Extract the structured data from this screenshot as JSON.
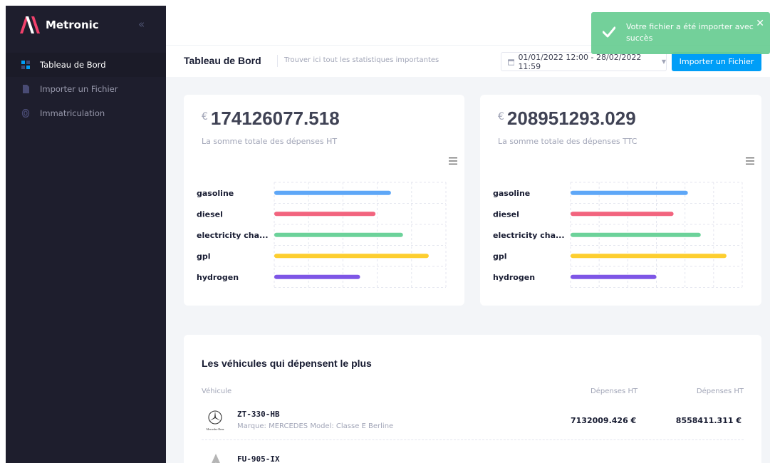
{
  "sidebar": {
    "brand": "Metronic",
    "items": [
      {
        "label": "Tableau de Bord",
        "active": true
      },
      {
        "label": "Importer un Fichier",
        "active": false
      },
      {
        "label": "Immatriculation",
        "active": false
      }
    ]
  },
  "subheader": {
    "title": "Tableau de Bord",
    "description": "Trouver ici tout les statistiques importantes",
    "date_range": "01/01/2022 12:00 - 28/02/2022 11:59",
    "import_label": "Importer un Fichier"
  },
  "toast": {
    "message": "Votre fichier a été importer avec succès"
  },
  "stats": [
    {
      "currency": "€",
      "value": "174126077.518",
      "label": "La somme totale des dépenses HT"
    },
    {
      "currency": "€",
      "value": "208951293.029",
      "label": "La somme totale des dépenses TTC"
    }
  ],
  "chart_data": [
    {
      "type": "bar",
      "orientation": "horizontal",
      "categories": [
        "gasoline",
        "diesel",
        "electricity cha...",
        "gpl",
        "hydrogen"
      ],
      "values": [
        34000000,
        29500000,
        37500000,
        45000000,
        25000000
      ],
      "xlim": [
        0,
        50000000
      ],
      "ticks": [
        "0M €",
        "10M €",
        "20M €",
        "30M €",
        "40M €",
        "50M €"
      ],
      "grid": true,
      "colors": [
        "#5ea7f7",
        "#f2647e",
        "#6cd29a",
        "#fdce2f",
        "#7e56e6"
      ]
    },
    {
      "type": "bar",
      "orientation": "horizontal",
      "categories": [
        "gasoline",
        "diesel",
        "electricity cha...",
        "gpl",
        "hydrogen"
      ],
      "values": [
        41000000,
        36000000,
        45500000,
        54500000,
        30000000
      ],
      "xlim": [
        0,
        60000000
      ],
      "ticks": [
        "0M €",
        "10M €",
        "20M €",
        "30M €",
        "40M €",
        "50M €",
        "60M €"
      ],
      "grid": true,
      "colors": [
        "#5ea7f7",
        "#f2647e",
        "#6cd29a",
        "#fdce2f",
        "#7e56e6"
      ]
    }
  ],
  "vehicles": {
    "title": "Les véhicules qui dépensent le plus",
    "columns": [
      "Véhicule",
      "Dépenses HT",
      "Dépenses HT"
    ],
    "rows": [
      {
        "plate": "ZT-330-HB",
        "details": "Marque: MERCEDES Model: Classe E Berline",
        "ht": "7132009.426 €",
        "ttc": "8558411.311 €",
        "logo_caption": "Mercedes-Benz"
      },
      {
        "plate": "FU-905-IX"
      }
    ]
  }
}
